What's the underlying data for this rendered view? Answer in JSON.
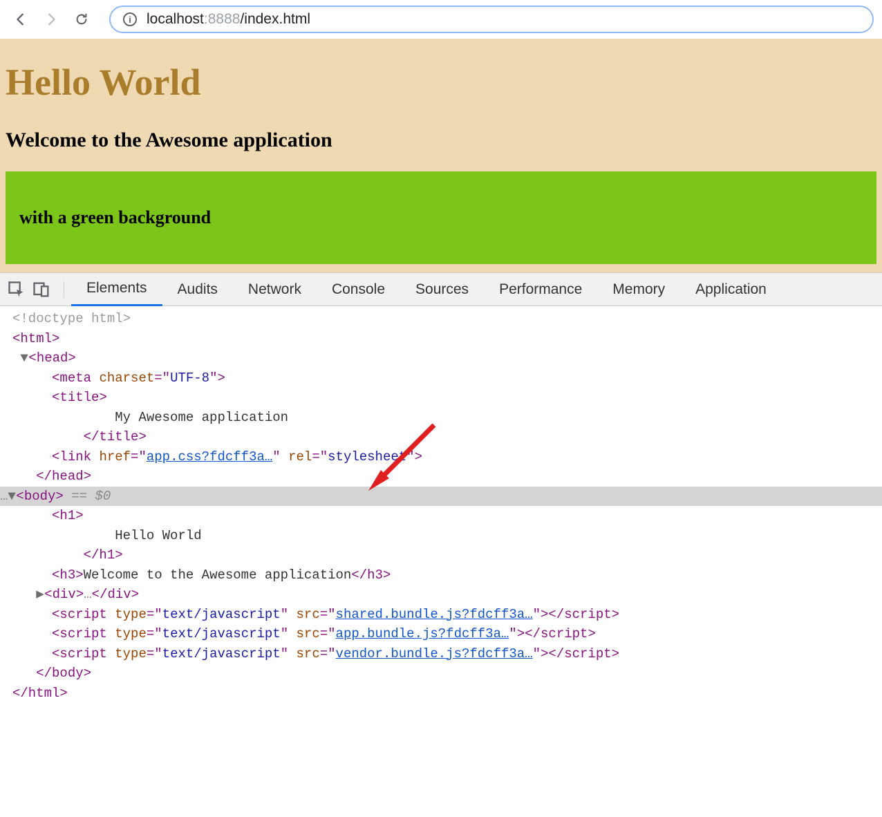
{
  "browser": {
    "url_host": "localhost",
    "url_port": ":8888",
    "url_path": "/index.html"
  },
  "page": {
    "h1": "Hello World",
    "h3": "Welcome to the Awesome application",
    "green_h3": "with a green background"
  },
  "devtools": {
    "tabs": [
      "Elements",
      "Audits",
      "Network",
      "Console",
      "Sources",
      "Performance",
      "Memory",
      "Application"
    ]
  },
  "dom": {
    "doctype": "<!doctype html>",
    "html_open": "html",
    "head_open": "head",
    "meta_charset_attr": "charset",
    "meta_charset_val": "UTF-8",
    "title_open": "title",
    "title_text": "My Awesome application",
    "title_close": "/title",
    "link_tag": "link",
    "link_href_attr": "href",
    "link_href_val": "app.css?fdcff3a…",
    "link_rel_attr": "rel",
    "link_rel_val": "stylesheet",
    "head_close": "/head",
    "body_open": "body",
    "eq0": " == $0",
    "h1_open": "h1",
    "h1_text": "Hello World",
    "h1_close": "/h1",
    "h3_open": "h3",
    "h3_text": "Welcome to the Awesome application",
    "h3_close": "/h3",
    "div_open": "div",
    "div_close": "/div",
    "script_tag": "script",
    "script_type_attr": "type",
    "script_type_val": "text/javascript",
    "script_src_attr": "src",
    "script1_src": "shared.bundle.js?fdcff3a…",
    "script2_src": "app.bundle.js?fdcff3a…",
    "script3_src": "vendor.bundle.js?fdcff3a…",
    "script_close": "/script",
    "body_close": "/body",
    "html_close": "/html"
  }
}
